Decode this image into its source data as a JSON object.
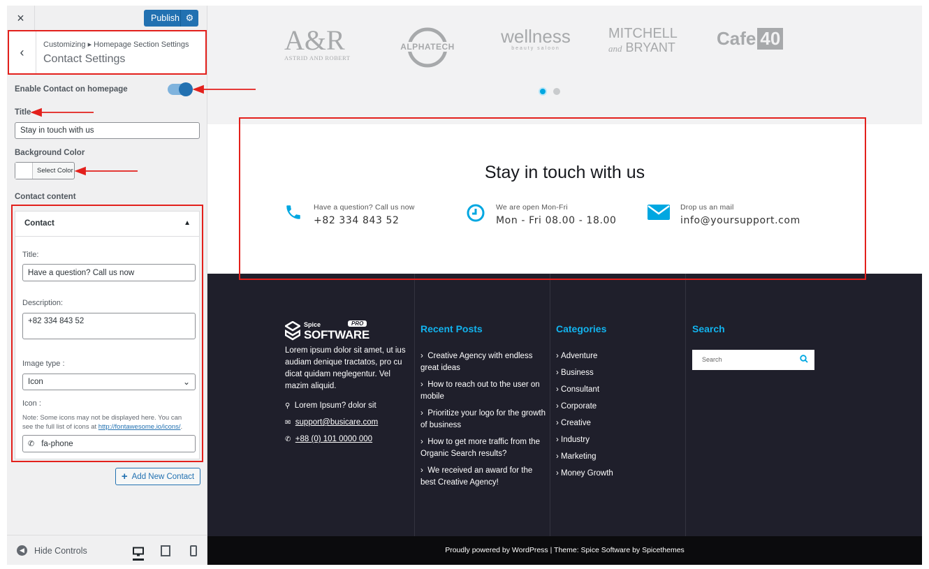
{
  "customizer": {
    "close_icon": "×",
    "publish_label": "Publish",
    "breadcrumb": "Customizing ▸ Homepage Section Settings",
    "section_title": "Contact Settings",
    "enable_label": "Enable Contact on homepage",
    "enable_on": true,
    "title_label": "Title",
    "title_value": "Stay in touch with us",
    "bg_color_label": "Background Color",
    "select_color_label": "Select Color",
    "contact_content_label": "Contact content",
    "repeater": {
      "item_title": "Contact",
      "title_field_label": "Title:",
      "title_field_value": "Have a question? Call us now",
      "description_label": "Description:",
      "description_value": "+82 334 843 52",
      "image_type_label": "Image type :",
      "image_type_value": "Icon",
      "icon_label": "Icon :",
      "icon_note": "Note: Some icons may not be displayed here. You can see the full list of icons at",
      "icon_note_link": "http://fontawesome.io/icons/",
      "icon_value": "fa-phone"
    },
    "add_new_label": "Add New Contact",
    "hide_controls_label": "Hide Controls"
  },
  "preview": {
    "logos": [
      "A&R",
      "ASTRID AND ROBERT",
      "ALPHATECH",
      "wellness",
      "beauty saloon",
      "MITCHELL",
      "and",
      "BRYANT",
      "Cafe",
      "40"
    ],
    "contact": {
      "title": "Stay in touch with us",
      "items": [
        {
          "icon": "phone-icon",
          "small": "Have a question? Call us now",
          "big": "+82 334 843 52"
        },
        {
          "icon": "clock-icon",
          "small": "We are open Mon-Fri",
          "big": "Mon - Fri 08.00 - 18.00"
        },
        {
          "icon": "envelope-icon",
          "small": "Drop us an mail",
          "big": "info@yoursupport.com"
        }
      ]
    },
    "footer": {
      "brand_small": "Spice",
      "brand_big": "SOFTWARE",
      "brand_badge": "PRO",
      "about": "Lorem ipsum dolor sit amet, ut ius audiam denique  tractatos, pro cu dicat quidam neglegentur. Vel mazim aliquid.",
      "address": "Lorem Ipsum? dolor sit",
      "email": "support@busicare.com",
      "phone": "+88 (0) 101 0000 000",
      "recent_posts_heading": "Recent Posts",
      "recent_posts": [
        "Creative Agency with endless great ideas",
        "How to reach out to the user on mobile",
        "Prioritize your logo for the growth of business",
        "How to get more traffic from the Organic Search results?",
        "We received an award for the best Creative Agency!"
      ],
      "categories_heading": "Categories",
      "categories": [
        "Adventure",
        "Business",
        "Consultant",
        "Corporate",
        "Creative",
        "Industry",
        "Marketing",
        "Money Growth"
      ],
      "search_heading": "Search",
      "search_placeholder": "Search",
      "copyright": "Proudly powered by WordPress | Theme: Spice Software by Spicethemes"
    }
  },
  "colors": {
    "accent": "#2271b1",
    "brand_blue": "#00a7e1",
    "footer_bg": "#1f1f2b",
    "annotation_red": "#e3201c"
  }
}
